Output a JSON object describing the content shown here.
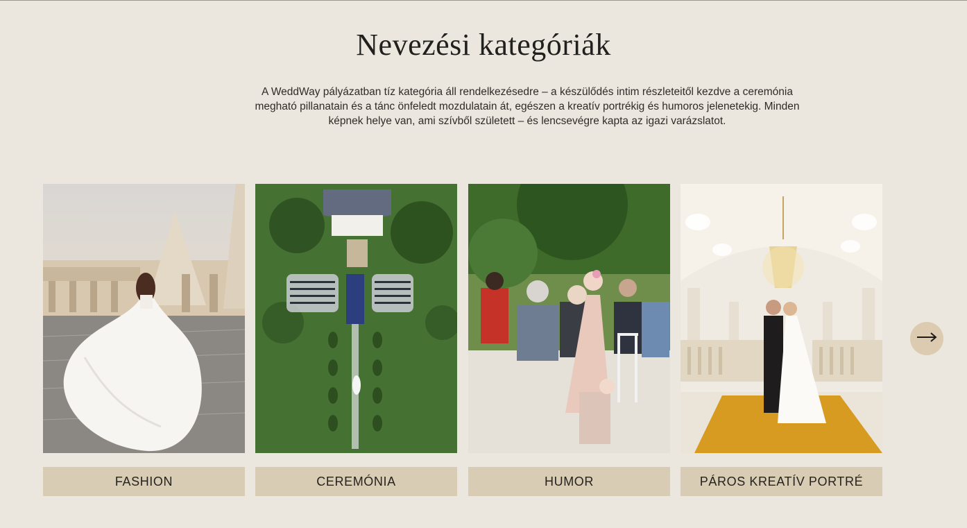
{
  "section": {
    "title": "Nevezési kategóriák",
    "intro": "A WeddWay pályázatban tíz kategória áll rendelkezésedre – a készülődés intim részleteitől kezdve a ceremónia megható pillanatain és a tánc önfeledt mozdulatain át, egészen a kreatív portrékig és humoros jelenetekig. Minden képnek helye van, ami szívből született – és lencsevégre kapta az igazi varázslatot."
  },
  "categories": [
    {
      "label": "FASHION"
    },
    {
      "label": "CEREMÓNIA"
    },
    {
      "label": "HUMOR"
    },
    {
      "label": "PÁROS KREATÍV PORTRÉ"
    }
  ],
  "carousel": {
    "next_icon": "arrow-right-icon"
  },
  "colors": {
    "background": "#ebe7df",
    "label_bg": "#d9ccb4",
    "next_button_bg": "#dccbb0"
  }
}
